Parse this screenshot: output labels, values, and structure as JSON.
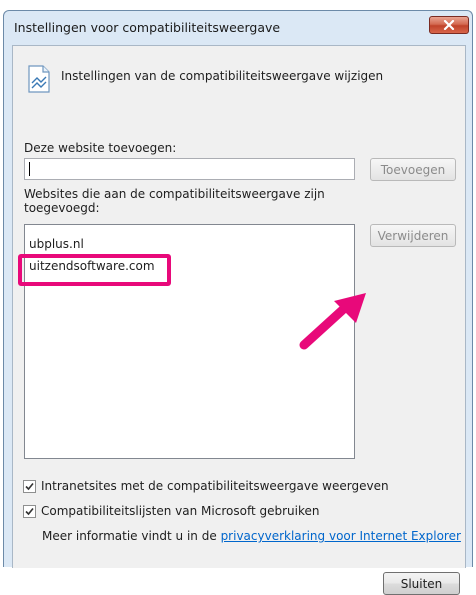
{
  "window": {
    "title": "Instellingen voor compatibiliteitsweergave"
  },
  "header": {
    "text": "Instellingen van de compatibiliteitsweergave wijzigen",
    "icon": "compat-view-icon"
  },
  "add_site": {
    "label": "Deze website toevoegen:",
    "value": "",
    "button_label": "Toevoegen"
  },
  "site_list": {
    "label": "Websites die aan de compatibiliteitsweergave zijn toegevoegd:",
    "items": [
      "ubplus.nl",
      "uitzendsoftware.com"
    ],
    "remove_label": "Verwijderen"
  },
  "options": [
    {
      "label": "Intranetsites met de compatibiliteitsweergave weergeven",
      "checked": true
    },
    {
      "label": "Compatibiliteitslijsten van Microsoft gebruiken",
      "checked": true
    }
  ],
  "info": {
    "prefix": "Meer informatie vindt u in de",
    "link": "privacyverklaring voor Internet Explorer"
  },
  "close_label": "Sluiten",
  "colors": {
    "annotation": "#e8097a",
    "link": "#0066cc",
    "close_button": "#c0432a"
  }
}
